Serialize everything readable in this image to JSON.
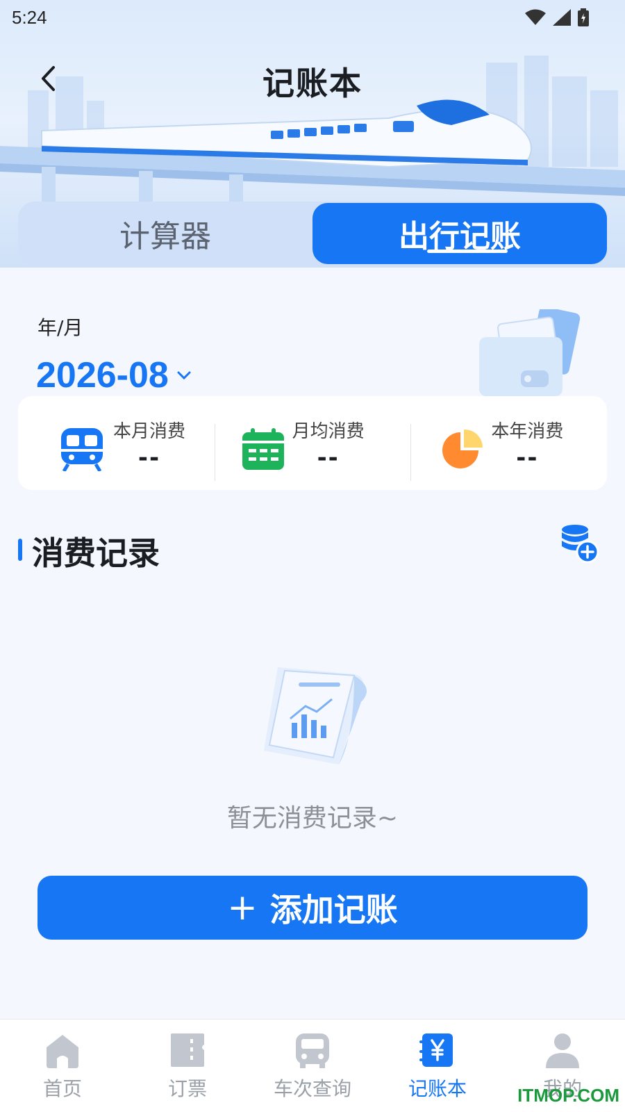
{
  "status_bar": {
    "time": "5:24"
  },
  "header": {
    "title": "记账本"
  },
  "segment": {
    "tabs": [
      {
        "label": "计算器",
        "active": false
      },
      {
        "label": "出行记账",
        "active": true
      }
    ]
  },
  "summary": {
    "period_label": "年/月",
    "period_value": "2026-08",
    "stats": [
      {
        "label": "本月消费",
        "value": "--",
        "icon": "train-icon"
      },
      {
        "label": "月均消费",
        "value": "--",
        "icon": "calendar-icon"
      },
      {
        "label": "本年消费",
        "value": "--",
        "icon": "pie-chart-icon"
      }
    ]
  },
  "records": {
    "title": "消费记录",
    "empty_text": "暂无消费记录~",
    "add_button": {
      "icon": "+",
      "label": "添加记账"
    }
  },
  "tabbar": {
    "items": [
      {
        "label": "首页",
        "icon": "home-icon",
        "active": false
      },
      {
        "label": "订票",
        "icon": "ticket-icon",
        "active": false
      },
      {
        "label": "车次查询",
        "icon": "bus-icon",
        "active": false
      },
      {
        "label": "记账本",
        "icon": "yen-book-icon",
        "active": true
      },
      {
        "label": "我的",
        "icon": "user-icon",
        "active": false
      }
    ]
  },
  "watermark": "ITMOP.COM",
  "colors": {
    "accent": "#1676f3",
    "green": "#1cb35a",
    "orange": "#ff8a30",
    "yellow": "#ffd66e"
  }
}
